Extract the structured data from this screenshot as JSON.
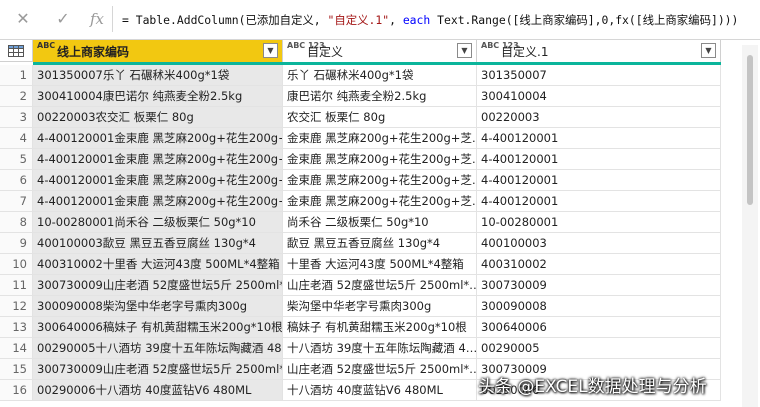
{
  "formula_bar": {
    "cancel_glyph": "✕",
    "ok_glyph": "✓",
    "fx_glyph": "fx",
    "formula_prefix": "= Table.AddColumn(已添加自定义, ",
    "formula_str": "\"自定义.1\"",
    "formula_mid": ", ",
    "formula_kw": "each",
    "formula_suffix": " Text.Range([线上商家编码],0,fx([线上商家编码])))"
  },
  "columns": [
    {
      "type": "ABC",
      "label": "线上商家编码",
      "selected": true
    },
    {
      "type": "ABC 123",
      "label": "自定义",
      "selected": false
    },
    {
      "type": "ABC 123",
      "label": "自定义.1",
      "selected": false
    }
  ],
  "colors": {
    "selected_header": "#f2c811",
    "quality_bar": "#0bb59b"
  },
  "rows": [
    {
      "n": "1",
      "c1": "301350007乐丫 石碾秫米400g*1袋",
      "c2": "乐丫 石碾秫米400g*1袋",
      "c3": "301350007"
    },
    {
      "n": "2",
      "c1": "300410004康巴诺尔 纯燕麦全粉2.5kg",
      "c2": "康巴诺尔 纯燕麦全粉2.5kg",
      "c3": "300410004"
    },
    {
      "n": "3",
      "c1": "00220003农交汇 板栗仁 80g",
      "c2": "农交汇 板栗仁 80g",
      "c3": "00220003"
    },
    {
      "n": "4",
      "c1": "4-400120001金束鹿 黑芝麻200g+花生200g+…",
      "c2": "金束鹿 黑芝麻200g+花生200g+芝…",
      "c3": "4-400120001"
    },
    {
      "n": "5",
      "c1": "4-400120001金束鹿 黑芝麻200g+花生200g+…",
      "c2": "金束鹿 黑芝麻200g+花生200g+芝…",
      "c3": "4-400120001"
    },
    {
      "n": "6",
      "c1": "4-400120001金束鹿 黑芝麻200g+花生200g+…",
      "c2": "金束鹿 黑芝麻200g+花生200g+芝…",
      "c3": "4-400120001"
    },
    {
      "n": "7",
      "c1": "4-400120001金束鹿 黑芝麻200g+花生200g+…",
      "c2": "金束鹿 黑芝麻200g+花生200g+芝…",
      "c3": "4-400120001"
    },
    {
      "n": "8",
      "c1": "10-00280001尚禾谷 二级板栗仁 50g*10",
      "c2": "尚禾谷 二级板栗仁 50g*10",
      "c3": "10-00280001"
    },
    {
      "n": "9",
      "c1": "400100003歃豆 黑豆五香豆腐丝 130g*4",
      "c2": "歃豆 黑豆五香豆腐丝 130g*4",
      "c3": "400100003"
    },
    {
      "n": "10",
      "c1": "400310002十里香 大运河43度 500ML*4整箱",
      "c2": "十里香 大运河43度 500ML*4整箱",
      "c3": "400310002"
    },
    {
      "n": "11",
      "c1": "300730009山庄老酒 52度盛世坛5斤 2500ml*…",
      "c2": "山庄老酒 52度盛世坛5斤 2500ml*…",
      "c3": "300730009"
    },
    {
      "n": "12",
      "c1": "300090008柴沟堡中华老字号熏肉300g",
      "c2": "柴沟堡中华老字号熏肉300g",
      "c3": "300090008"
    },
    {
      "n": "13",
      "c1": "300640006稿妹子 有机黄甜糯玉米200g*10根",
      "c2": "稿妹子 有机黄甜糯玉米200g*10根",
      "c3": "300640006"
    },
    {
      "n": "14",
      "c1": "00290005十八酒坊 39度十五年陈坛陶藏酒 48…",
      "c2": "十八酒坊 39度十五年陈坛陶藏酒 4…",
      "c3": "00290005"
    },
    {
      "n": "15",
      "c1": "300730009山庄老酒 52度盛世坛5斤 2500ml*…",
      "c2": "山庄老酒 52度盛世坛5斤 2500ml*…",
      "c3": "300730009"
    },
    {
      "n": "16",
      "c1": "00290006十八酒坊 40度蓝钻V6 480ML",
      "c2": "十八酒坊 40度蓝钻V6 480ML",
      "c3": "00290006"
    }
  ],
  "watermark": "头条 @EXCEL数据处理与分析"
}
